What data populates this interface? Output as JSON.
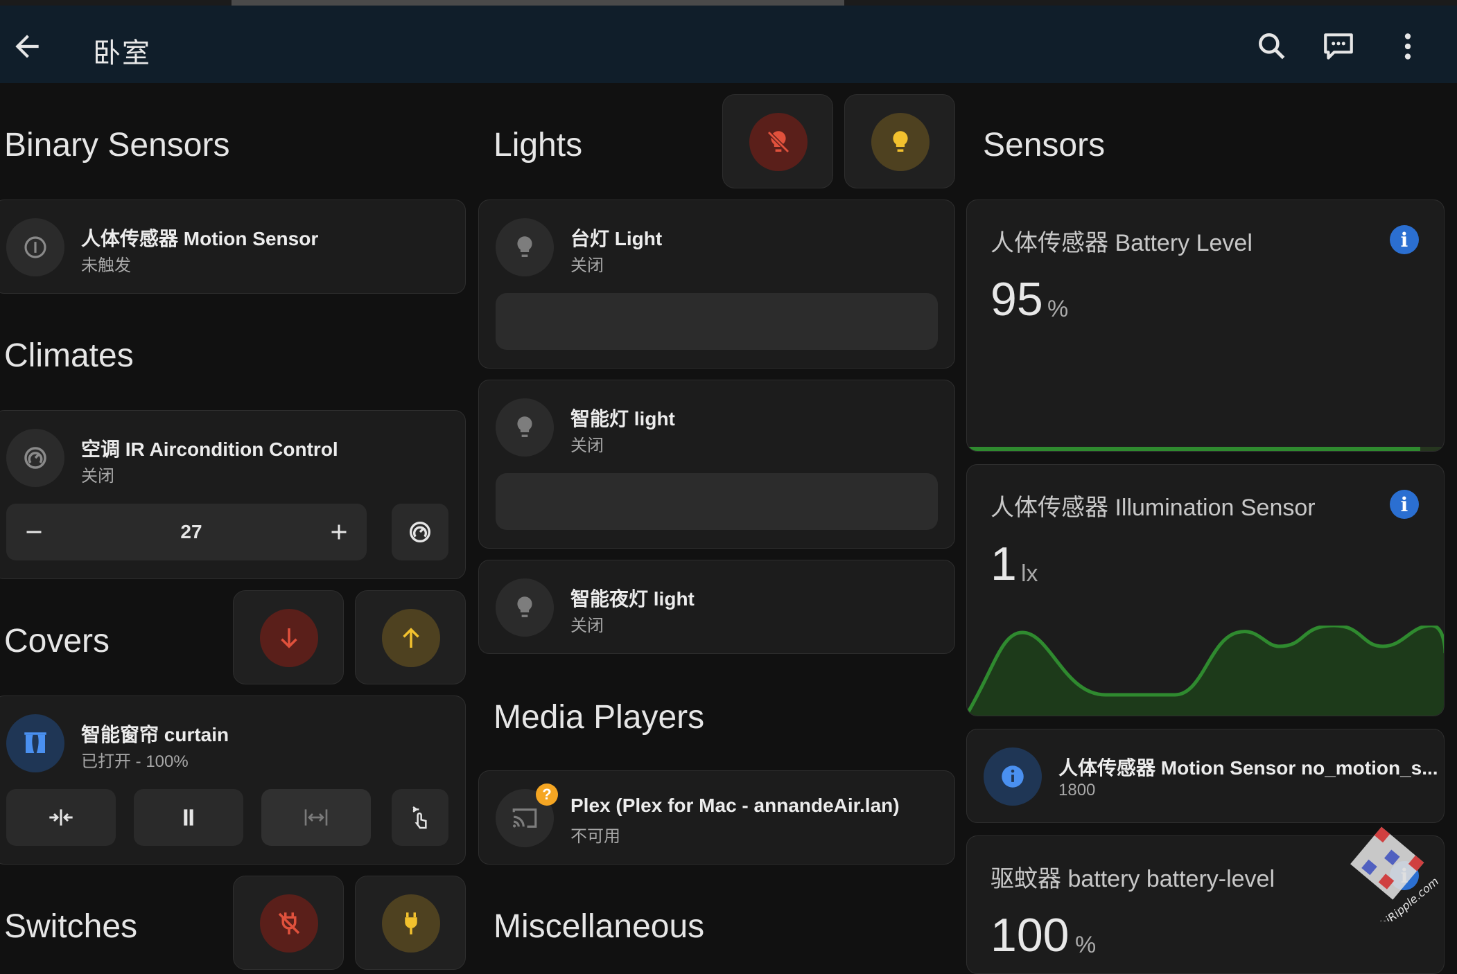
{
  "appbar": {
    "title": "卧室",
    "icons": [
      "back-arrow-icon",
      "search-icon",
      "assist-chat-icon",
      "more-vertical-icon"
    ]
  },
  "sections": {
    "binary_sensors": "Binary Sensors",
    "climates": "Climates",
    "covers": "Covers",
    "switches": "Switches",
    "lights": "Lights",
    "media_players": "Media Players",
    "miscellaneous": "Miscellaneous",
    "sensors": "Sensors"
  },
  "binary_sensor": {
    "name": "人体传感器 Motion Sensor",
    "state": "未触发"
  },
  "climate": {
    "name": "空调 IR Aircondition Control",
    "state": "关闭",
    "target_temp": "27"
  },
  "cover": {
    "name": "智能窗帘 curtain",
    "state": "已打开 - 100%"
  },
  "lights": [
    {
      "name": "台灯 Light",
      "state": "关闭"
    },
    {
      "name": "智能灯 light",
      "state": "关闭"
    },
    {
      "name": "智能夜灯 light",
      "state": "关闭"
    }
  ],
  "media_player": {
    "name": "Plex (Plex for Mac - annandeAir.lan)",
    "state": "不可用",
    "badge": "?"
  },
  "sensors": {
    "battery": {
      "title": "人体传感器 Battery Level",
      "value": "95",
      "unit": "%",
      "level": 0.95
    },
    "illumination": {
      "title": "人体传感器 Illumination Sensor",
      "value": "1",
      "unit": "lx"
    },
    "no_motion": {
      "name": "人体传感器 Motion Sensor no_motion_s...",
      "state": "1800"
    },
    "repeller": {
      "title": "驱蚊器 battery battery-level",
      "value": "100",
      "unit": "%"
    }
  },
  "watermark": {
    "text": "hiRipple.com"
  },
  "colors": {
    "appbar": "#101e2a",
    "background": "#111111",
    "card": "#1c1c1c",
    "red_accent": "#e0513c",
    "yellow_accent": "#f2c12e",
    "info_blue": "#2b6fd1",
    "graph_green": "#2f8a2f"
  }
}
